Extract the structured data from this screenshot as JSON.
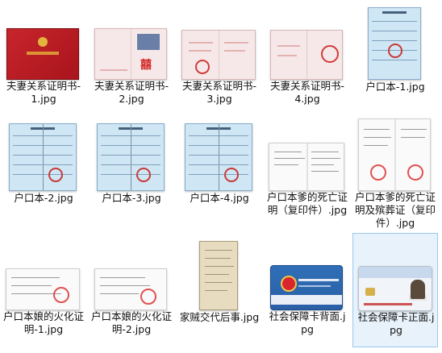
{
  "files": [
    {
      "id": "f1",
      "label": "夫妻关系证明书-1.jpg",
      "kind": "red-cover",
      "selected": false
    },
    {
      "id": "f2",
      "label": "夫妻关系证明书-2.jpg",
      "kind": "cert-photo",
      "selected": false
    },
    {
      "id": "f3",
      "label": "夫妻关系证明书-3.jpg",
      "kind": "cert",
      "selected": false
    },
    {
      "id": "f4",
      "label": "夫妻关系证明书-4.jpg",
      "kind": "cert-stamp",
      "selected": false
    },
    {
      "id": "f5",
      "label": "户口本-1.jpg",
      "kind": "hukou-tall",
      "selected": false
    },
    {
      "id": "f6",
      "label": "户口本-2.jpg",
      "kind": "hukou",
      "selected": false
    },
    {
      "id": "f7",
      "label": "户口本-3.jpg",
      "kind": "hukou",
      "selected": false
    },
    {
      "id": "f8",
      "label": "户口本-4.jpg",
      "kind": "hukou",
      "selected": false
    },
    {
      "id": "f9",
      "label": "户口本爹的死亡证明（复印件）.jpg",
      "kind": "doc-spread",
      "selected": false
    },
    {
      "id": "f10",
      "label": "户口本爹的死亡证明及殡葬证（复印件）.jpg",
      "kind": "doc-spread",
      "selected": false
    },
    {
      "id": "f11",
      "label": "户口本娘的火化证明-1.jpg",
      "kind": "doc-stamp",
      "selected": false
    },
    {
      "id": "f12",
      "label": "户口本娘的火化证明-2.jpg",
      "kind": "doc-stamp",
      "selected": false
    },
    {
      "id": "f13",
      "label": "家贼交代后事.jpg",
      "kind": "old-paper",
      "selected": false
    },
    {
      "id": "f14",
      "label": "社会保障卡背面.jpg",
      "kind": "card-back",
      "selected": false
    },
    {
      "id": "f15",
      "label": "社会保障卡正面.jpg",
      "kind": "card-front",
      "selected": true
    }
  ]
}
